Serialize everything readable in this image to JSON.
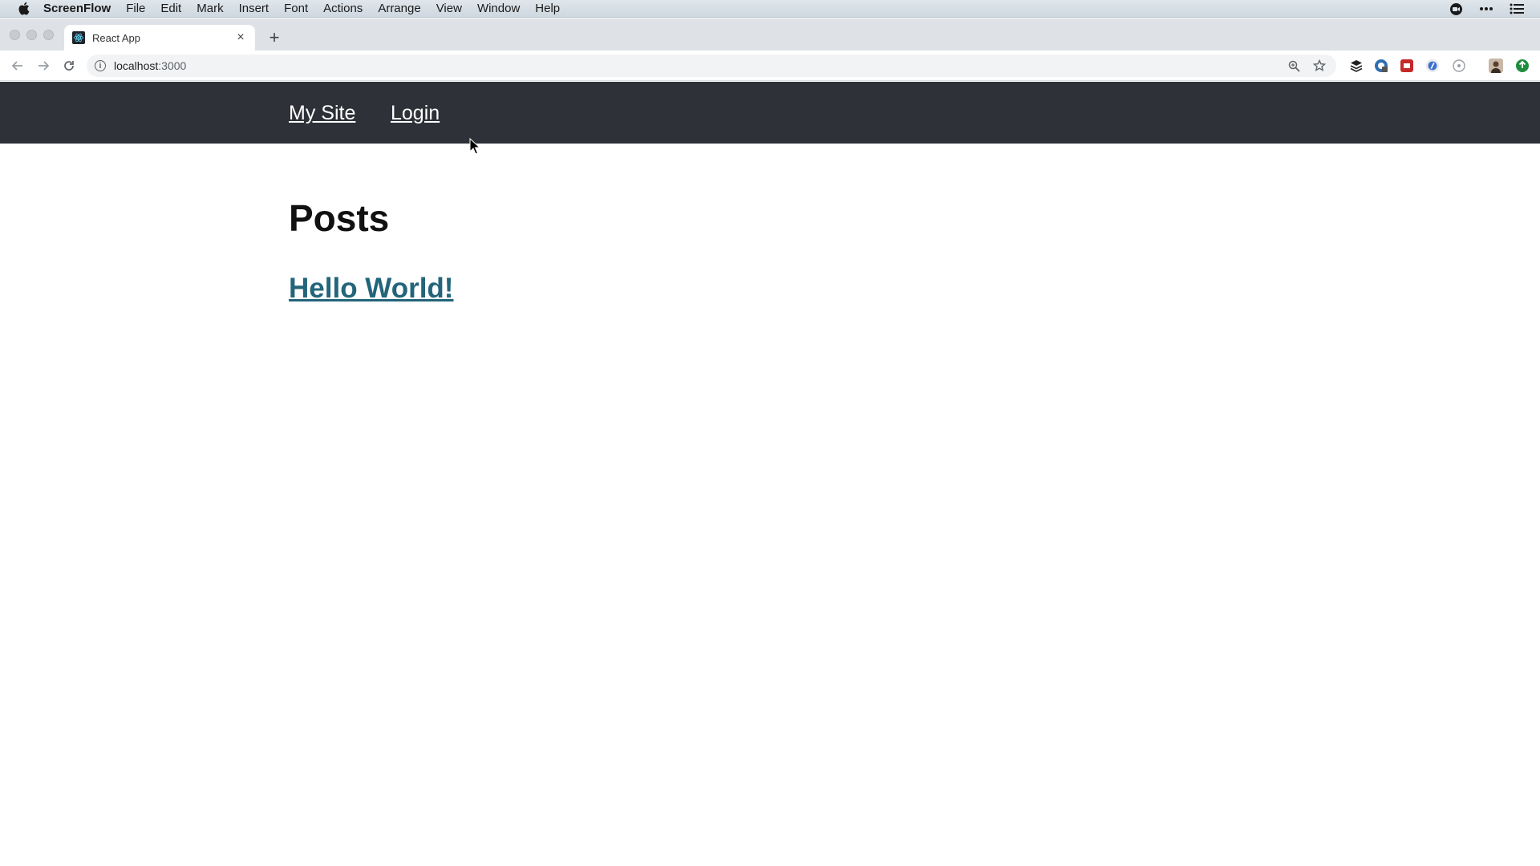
{
  "menubar": {
    "app_name": "ScreenFlow",
    "items": [
      "File",
      "Edit",
      "Mark",
      "Insert",
      "Font",
      "Actions",
      "Arrange",
      "View",
      "Window",
      "Help"
    ],
    "right_icons": [
      "screen-record-icon",
      "more-icon",
      "list-icon"
    ]
  },
  "browser": {
    "tab_title": "React App",
    "new_tab_label": "+",
    "tab_close_label": "×",
    "url_host": "localhost",
    "url_port": ":3000",
    "extensions": [
      "layers-icon",
      "extension-icon-1",
      "extension-icon-2",
      "extension-icon-3",
      "extension-icon-4",
      "profile-avatar",
      "update-icon"
    ]
  },
  "site": {
    "brand": "My Site",
    "login": "Login",
    "heading": "Posts",
    "posts": [
      {
        "title": "Hello World!"
      }
    ]
  },
  "colors": {
    "header_bg": "#2f3138",
    "link": "#23657a",
    "menubar_bg": "#dfe6ec"
  }
}
